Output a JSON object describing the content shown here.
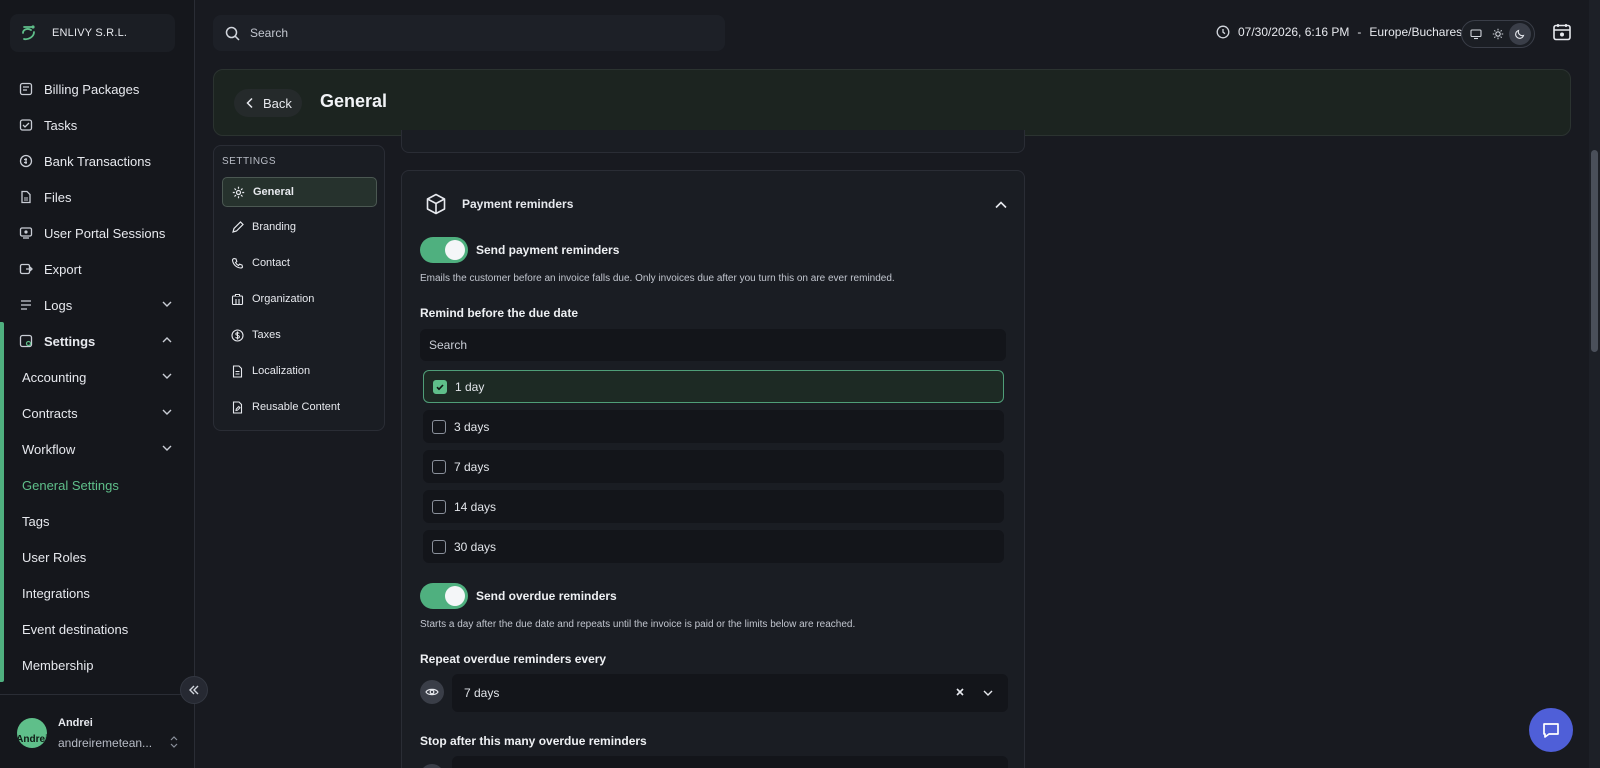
{
  "brand": {
    "name": "ENLIVY S.R.L."
  },
  "sidebar": {
    "items": [
      {
        "label": "Billing Packages",
        "icon": "billing-icon"
      },
      {
        "label": "Tasks",
        "icon": "tasks-icon"
      },
      {
        "label": "Bank Transactions",
        "icon": "bank-icon"
      },
      {
        "label": "Files",
        "icon": "file-icon"
      },
      {
        "label": "User Portal Sessions",
        "icon": "portal-icon"
      },
      {
        "label": "Export",
        "icon": "export-icon"
      },
      {
        "label": "Logs",
        "icon": "logs-icon"
      },
      {
        "label": "Settings",
        "icon": "settings-icon"
      }
    ],
    "settings_children": [
      {
        "label": "Accounting"
      },
      {
        "label": "Contracts"
      },
      {
        "label": "Workflow"
      },
      {
        "label": "General Settings"
      },
      {
        "label": "Tags"
      },
      {
        "label": "User Roles"
      },
      {
        "label": "Integrations"
      },
      {
        "label": "Event destinations"
      },
      {
        "label": "Membership"
      }
    ]
  },
  "user": {
    "name": "Andrei",
    "email": "andreiremetean...",
    "avatar_text": "Andrei"
  },
  "topbar": {
    "search_placeholder": "Search",
    "datetime": "07/30/2026, 6:16 PM",
    "separator": "-",
    "timezone": "Europe/Bucharest"
  },
  "header": {
    "back_label": "Back",
    "title": "General"
  },
  "subnav": {
    "title": "SETTINGS",
    "items": [
      {
        "label": "General"
      },
      {
        "label": "Branding"
      },
      {
        "label": "Contact"
      },
      {
        "label": "Organization"
      },
      {
        "label": "Taxes"
      },
      {
        "label": "Localization"
      },
      {
        "label": "Reusable Content"
      }
    ]
  },
  "payment_reminders": {
    "title": "Payment reminders",
    "send_label": "Send payment reminders",
    "send_help": "Emails the customer before an invoice falls due. Only invoices due after you turn this on are ever reminded.",
    "remind_before_label": "Remind before the due date",
    "filter_placeholder": "Search",
    "options": [
      {
        "label": "1 day",
        "checked": true
      },
      {
        "label": "3 days",
        "checked": false
      },
      {
        "label": "7 days",
        "checked": false
      },
      {
        "label": "14 days",
        "checked": false
      },
      {
        "label": "30 days",
        "checked": false
      }
    ],
    "overdue_label": "Send overdue reminders",
    "overdue_help": "Starts a day after the due date and repeats until the invoice is paid or the limits below are reached.",
    "repeat_label": "Repeat overdue reminders every",
    "repeat_value": "7 days",
    "stop_label": "Stop after this many overdue reminders"
  },
  "colors": {
    "accent": "#4fb07f",
    "chat": "#4f5fd8"
  }
}
